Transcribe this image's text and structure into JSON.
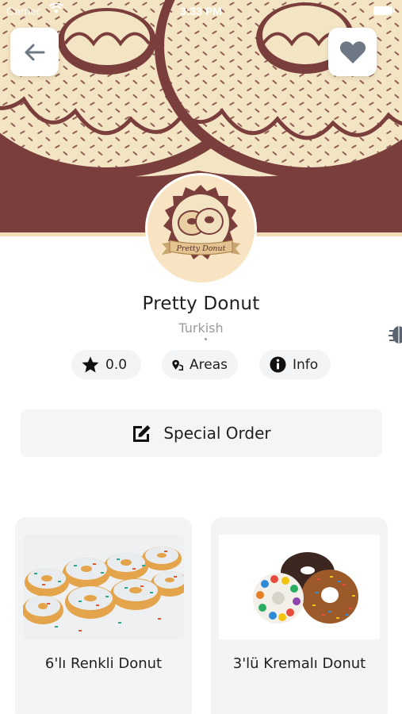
{
  "status_bar": {
    "carrier": "Carrier",
    "time": "3:33 PM"
  },
  "header": {
    "back_icon": "arrow-left-icon",
    "favorite_icon": "heart-icon"
  },
  "store": {
    "name": "Pretty Donut",
    "cuisine": "Turkish",
    "logo_text": "Pretty Donut"
  },
  "stats": {
    "rating_icon": "star-icon",
    "rating": "0.0",
    "areas_icon": "map-pin-icon",
    "areas_label": "Areas",
    "info_icon": "info-icon",
    "info_label": "Info"
  },
  "special_order": {
    "icon": "edit-icon",
    "label": "Special Order"
  },
  "products": [
    {
      "name": "6'lı Renkli Donut"
    },
    {
      "name": "3'lü Kremalı Donut"
    }
  ],
  "colors": {
    "brand_brown": "#7a3e3c",
    "brand_cream": "#f3e4c3",
    "pill_bg": "#f3f4f6",
    "button_gray": "#6e7884"
  }
}
